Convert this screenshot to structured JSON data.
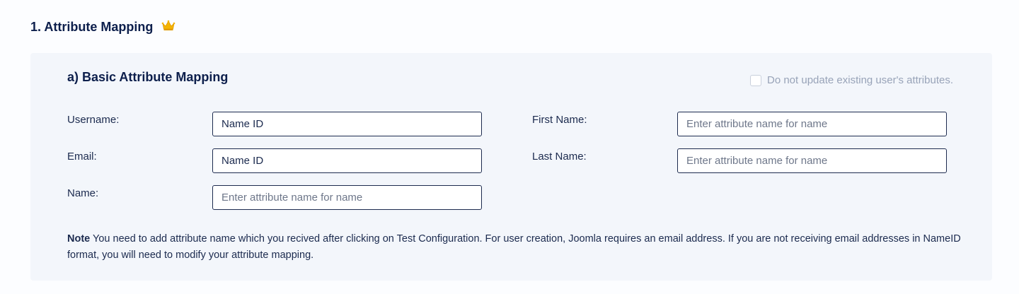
{
  "section": {
    "title": "1. Attribute Mapping",
    "crown_icon": "crown-icon",
    "crown_color": "#f5b400"
  },
  "basic": {
    "title": "a) Basic Attribute Mapping",
    "no_update_label": "Do not update existing user's attributes.",
    "no_update_checked": false,
    "fields": {
      "username": {
        "label": "Username:",
        "value": "Name ID",
        "placeholder": ""
      },
      "email": {
        "label": "Email:",
        "value": "Name ID",
        "placeholder": ""
      },
      "name": {
        "label": "Name:",
        "value": "",
        "placeholder": "Enter attribute name for name"
      },
      "first_name": {
        "label": "First Name:",
        "value": "",
        "placeholder": "Enter attribute name for name"
      },
      "last_name": {
        "label": "Last Name:",
        "value": "",
        "placeholder": "Enter attribute name for name"
      }
    },
    "note_label": "Note",
    "note_text": " You need to add attribute name which you recived after clicking on Test Configuration. For user creation, Joomla requires an email address. If you are not receiving email addresses in NameID format, you will need to modify your attribute mapping."
  },
  "colors": {
    "heading": "#0d1f4c",
    "panel_bg": "#f3f6fb",
    "input_border": "#1d2b4f",
    "muted_text": "#98a3b8"
  }
}
